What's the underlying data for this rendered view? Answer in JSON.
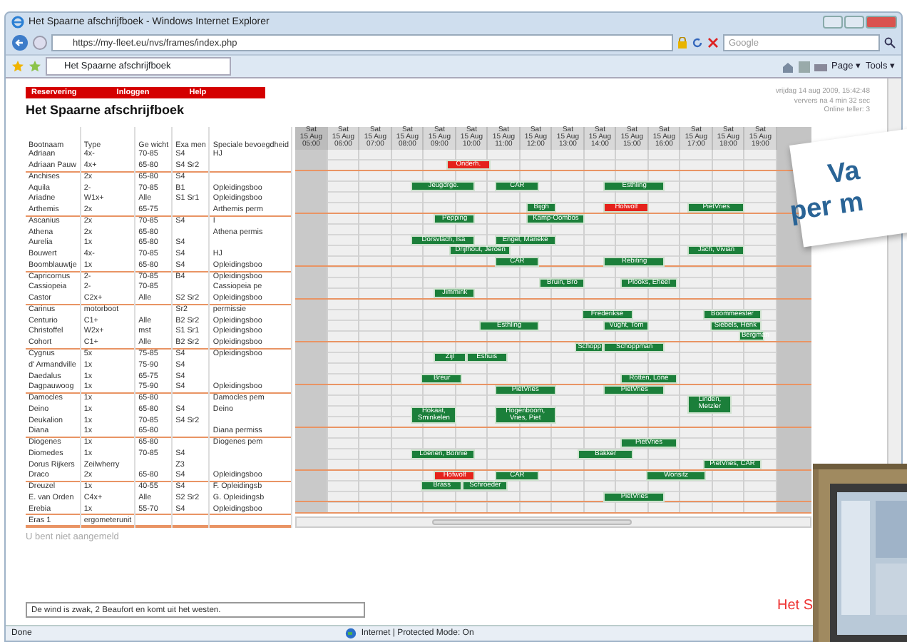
{
  "window": {
    "title": "Het Spaarne afschrijfboek - Windows Internet Explorer"
  },
  "address_bar": {
    "url": "https://my-fleet.eu/nvs/frames/index.php",
    "search_placeholder": "Google"
  },
  "tab": {
    "label": "Het Spaarne afschrijfboek"
  },
  "command_bar": [
    "Page ▾",
    "Tools ▾"
  ],
  "site_nav": [
    "Reservering",
    "Inloggen",
    "Help"
  ],
  "heading": "Het Spaarne afschrijfboek",
  "info_lines": [
    "vrijdag 14 aug 2009, 15:42:48",
    "ververs na 4 min 32 sec",
    "Online teller: 3"
  ],
  "table": {
    "columns": [
      "Bootnaam",
      "Type",
      "Ge wicht",
      "Exa men",
      "Speciale bevoegdheid"
    ],
    "rows": [
      {
        "cells": [
          "Adriaan",
          "4x-",
          "70-85",
          "S4",
          "HJ"
        ],
        "divider": false,
        "bookings": []
      },
      {
        "cells": [
          "Adriaan Pauw",
          "4x+",
          "65-80",
          "S4 Sr2",
          ""
        ],
        "divider": true,
        "bookings": [
          {
            "label": "Onderh.",
            "color": "#e5231b"
          }
        ]
      },
      {
        "cells": [
          "Anchises",
          "2x",
          "65-80",
          "S4",
          ""
        ],
        "divider": false,
        "bookings": []
      },
      {
        "cells": [
          "Aquila",
          "2-",
          "70-85",
          "B1",
          "Opleidingsboo"
        ],
        "divider": false,
        "bookings": [
          {
            "label": "Jeugdrge.",
            "color": "#1b7f3a"
          },
          {
            "label": "CAR",
            "color": "#1b7f3a"
          },
          {
            "label": "Esthling",
            "color": "#1b7f3a"
          }
        ]
      },
      {
        "cells": [
          "Ariadne",
          "W1x+",
          "Alle",
          "S1 Sr1",
          "Opleidingsboo"
        ],
        "divider": false,
        "bookings": []
      },
      {
        "cells": [
          "Arthemis",
          "2x",
          "65-75",
          "",
          "Arthemis perm"
        ],
        "divider": true,
        "bookings": [
          {
            "label": "Bijgh",
            "color": "#1b7f3a"
          },
          {
            "label": "Hofwolf",
            "color": "#e5231b"
          },
          {
            "label": "PietVries",
            "color": "#1b7f3a"
          }
        ]
      },
      {
        "cells": [
          "Ascanius",
          "2x",
          "70-85",
          "S4",
          "I"
        ],
        "divider": false,
        "bookings": [
          {
            "label": "Pepping",
            "color": "#1b7f3a"
          },
          {
            "label": "Kamp-Oombos",
            "color": "#1b7f3a"
          }
        ]
      },
      {
        "cells": [
          "Athena",
          "2x",
          "65-80",
          "",
          "Athena permis"
        ],
        "divider": false,
        "bookings": []
      },
      {
        "cells": [
          "Aurelia",
          "1x",
          "65-80",
          "S4",
          ""
        ],
        "divider": false,
        "bookings": [
          {
            "label": "Dorsvlach, Isa",
            "color": "#1b7f3a"
          },
          {
            "label": "Engel, Marieke",
            "color": "#1b7f3a"
          }
        ]
      },
      {
        "cells": [
          "Bouwert",
          "4x-",
          "70-85",
          "S4",
          "HJ"
        ],
        "divider": false,
        "bookings": [
          {
            "label": "Drijfhout, Jeroen",
            "color": "#1b7f3a"
          },
          {
            "label": "Jach, Vivian",
            "color": "#1b7f3a"
          }
        ]
      },
      {
        "cells": [
          "Boomblauwtje",
          "1x",
          "65-80",
          "S4",
          "Opleidingsboo"
        ],
        "divider": true,
        "bookings": [
          {
            "label": "CAR",
            "color": "#1b7f3a"
          },
          {
            "label": "Rebiting",
            "color": "#1b7f3a"
          }
        ]
      },
      {
        "cells": [
          "Capricornus",
          "2-",
          "70-85",
          "B4",
          "Opleidingsboo"
        ],
        "divider": false,
        "bookings": []
      },
      {
        "cells": [
          "Cassiopeia",
          "2-",
          "70-85",
          "",
          "Cassiopeia pe"
        ],
        "divider": false,
        "bookings": [
          {
            "label": "Bruin, Bro",
            "color": "#1b7f3a"
          },
          {
            "label": "Plooks, Eheel",
            "color": "#1b7f3a"
          }
        ]
      },
      {
        "cells": [
          "Castor",
          "C2x+",
          "Alle",
          "S2 Sr2",
          "Opleidingsboo"
        ],
        "divider": true,
        "bookings": [
          {
            "label": "Jimmink",
            "color": "#1b7f3a"
          }
        ]
      },
      {
        "cells": [
          "Carinus",
          "motorboot",
          "",
          "Sr2",
          "permissie"
        ],
        "divider": false,
        "bookings": []
      },
      {
        "cells": [
          "Centurio",
          "C1+",
          "Alle",
          "B2 Sr2",
          "Opleidingsboo"
        ],
        "divider": false,
        "bookings": [
          {
            "label": "Frederikse",
            "color": "#1b7f3a"
          },
          {
            "label": "Boommeester",
            "color": "#1b7f3a"
          }
        ]
      },
      {
        "cells": [
          "Christoffel",
          "W2x+",
          "mst",
          "S1 Sr1",
          "Opleidingsboo"
        ],
        "divider": false,
        "bookings": [
          {
            "label": "Esthling",
            "color": "#1b7f3a"
          },
          {
            "label": "Vught, Tom",
            "color": "#1b7f3a"
          },
          {
            "label": "Siebels, Henk",
            "color": "#1b7f3a"
          }
        ]
      },
      {
        "cells": [
          "Cohort",
          "C1+",
          "Alle",
          "B2 Sr2",
          "Opleidingsboo"
        ],
        "divider": true,
        "bookings": [
          {
            "label": "Bergman",
            "color": "#1b7f3a"
          }
        ]
      },
      {
        "cells": [
          "Cygnus",
          "5x",
          "75-85",
          "S4",
          "Opleidingsboo"
        ],
        "divider": false,
        "bookings": [
          {
            "label": "Schopp",
            "color": "#1b7f3a"
          },
          {
            "label": "Schoppman",
            "color": "#1b7f3a"
          }
        ]
      },
      {
        "cells": [
          "d' Armandville",
          "1x",
          "75-90",
          "S4",
          ""
        ],
        "divider": false,
        "bookings": [
          {
            "label": "Zijl",
            "color": "#1b7f3a"
          },
          {
            "label": "Eshuis",
            "color": "#1b7f3a"
          }
        ]
      },
      {
        "cells": [
          "Daedalus",
          "1x",
          "65-75",
          "S4",
          ""
        ],
        "divider": false,
        "bookings": []
      },
      {
        "cells": [
          "Dagpauwoog",
          "1x",
          "75-90",
          "S4",
          "Opleidingsboo"
        ],
        "divider": true,
        "bookings": [
          {
            "label": "Breur",
            "color": "#1b7f3a"
          },
          {
            "label": "Rotten, Lone",
            "color": "#1b7f3a"
          }
        ]
      },
      {
        "cells": [
          "Damocles",
          "1x",
          "65-80",
          "",
          "Damocles pem"
        ],
        "divider": false,
        "bookings": [
          {
            "label": "PietVries",
            "color": "#1b7f3a"
          },
          {
            "label": "PietVries",
            "color": "#1b7f3a"
          }
        ]
      },
      {
        "cells": [
          "Deino",
          "1x",
          "65-80",
          "S4",
          "Deino"
        ],
        "divider": false,
        "bookings": [
          {
            "label": "Linden, Metzler",
            "color": "#1b7f3a"
          }
        ]
      },
      {
        "cells": [
          "Deukalion",
          "1x",
          "70-85",
          "S4 Sr2",
          ""
        ],
        "divider": false,
        "bookings": [
          {
            "label": "Hokaat, Sminkelen",
            "color": "#1b7f3a"
          },
          {
            "label": "Hogenboom, Vries, Piet",
            "color": "#1b7f3a"
          }
        ]
      },
      {
        "cells": [
          "Diana",
          "1x",
          "65-80",
          "",
          "Diana permiss"
        ],
        "divider": true,
        "bookings": []
      },
      {
        "cells": [
          "Diogenes",
          "1x",
          "65-80",
          "",
          "Diogenes pem"
        ],
        "divider": false,
        "bookings": []
      },
      {
        "cells": [
          "Diomedes",
          "1x",
          "70-85",
          "S4",
          ""
        ],
        "divider": false,
        "bookings": [
          {
            "label": "PietVries",
            "color": "#1b7f3a"
          }
        ]
      },
      {
        "cells": [
          "Dorus Rijkers",
          "Zeilwherry",
          "",
          "Z3",
          ""
        ],
        "divider": false,
        "bookings": [
          {
            "label": "Loenen, Bonnie",
            "color": "#1b7f3a"
          },
          {
            "label": "Bakker",
            "color": "#1b7f3a"
          }
        ]
      },
      {
        "cells": [
          "Draco",
          "2x",
          "65-80",
          "S4",
          "Opleidingsboo"
        ],
        "divider": true,
        "bookings": [
          {
            "label": "PietVries, CAR",
            "color": "#1b7f3a"
          }
        ]
      },
      {
        "cells": [
          "Dreuzel",
          "1x",
          "40-55",
          "S4",
          "F. Opleidingsb"
        ],
        "divider": false,
        "bookings": [
          {
            "label": "Hofwolf",
            "color": "#e5231b"
          },
          {
            "label": "CAR",
            "color": "#1b7f3a"
          },
          {
            "label": "Wonsitz",
            "color": "#1b7f3a"
          }
        ]
      },
      {
        "cells": [
          "E. van Orden",
          "C4x+",
          "Alle",
          "S2 Sr2",
          "G. Opleidingsb"
        ],
        "divider": false,
        "bookings": [
          {
            "label": "Brass",
            "color": "#1b7f3a"
          },
          {
            "label": "Schroeder",
            "color": "#1b7f3a"
          }
        ]
      },
      {
        "cells": [
          "Erebia",
          "1x",
          "55-70",
          "S4",
          "Opleidingsboo"
        ],
        "divider": true,
        "bookings": [
          {
            "label": "PietVries",
            "color": "#1b7f3a"
          }
        ]
      },
      {
        "cells": [
          "Eras 1",
          "ergometerunit",
          "",
          "",
          ""
        ],
        "divider": true,
        "bookings": []
      }
    ]
  },
  "timeline": {
    "columns": [
      {
        "day": "Sat",
        "date": "15 Aug",
        "time": "05:00",
        "shaded": true
      },
      {
        "day": "Sat",
        "date": "15 Aug",
        "time": "06:00",
        "shaded": false
      },
      {
        "day": "Sat",
        "date": "15 Aug",
        "time": "07:00",
        "shaded": false
      },
      {
        "day": "Sat",
        "date": "15 Aug",
        "time": "08:00",
        "shaded": false
      },
      {
        "day": "Sat",
        "date": "15 Aug",
        "time": "09:00",
        "shaded": false
      },
      {
        "day": "Sat",
        "date": "15 Aug",
        "time": "10:00",
        "shaded": false
      },
      {
        "day": "Sat",
        "date": "15 Aug",
        "time": "11:00",
        "shaded": false
      },
      {
        "day": "Sat",
        "date": "15 Aug",
        "time": "12:00",
        "shaded": false
      },
      {
        "day": "Sat",
        "date": "15 Aug",
        "time": "13:00",
        "shaded": false
      },
      {
        "day": "Sat",
        "date": "15 Aug",
        "time": "14:00",
        "shaded": false
      },
      {
        "day": "Sat",
        "date": "15 Aug",
        "time": "15:00",
        "shaded": false
      },
      {
        "day": "Sat",
        "date": "15 Aug",
        "time": "16:00",
        "shaded": false
      },
      {
        "day": "Sat",
        "date": "15 Aug",
        "time": "17:00",
        "shaded": false
      },
      {
        "day": "Sat",
        "date": "15 Aug",
        "time": "18:00",
        "shaded": false
      },
      {
        "day": "Sat",
        "date": "15 Aug",
        "time": "19:00",
        "shaded": false
      }
    ]
  },
  "login_status": "U bent niet aangemeld",
  "weather_field": {
    "value": "De wind is zwak, 2 Beaufort en komt uit het westen."
  },
  "footer_brand": "Het S",
  "status_bar": {
    "left": "Done",
    "zone": "Internet | Protected Mode: On"
  },
  "overlay_card": {
    "lines": [
      "Va",
      "per m"
    ]
  },
  "overlay_photo": {
    "kind": "picture"
  }
}
